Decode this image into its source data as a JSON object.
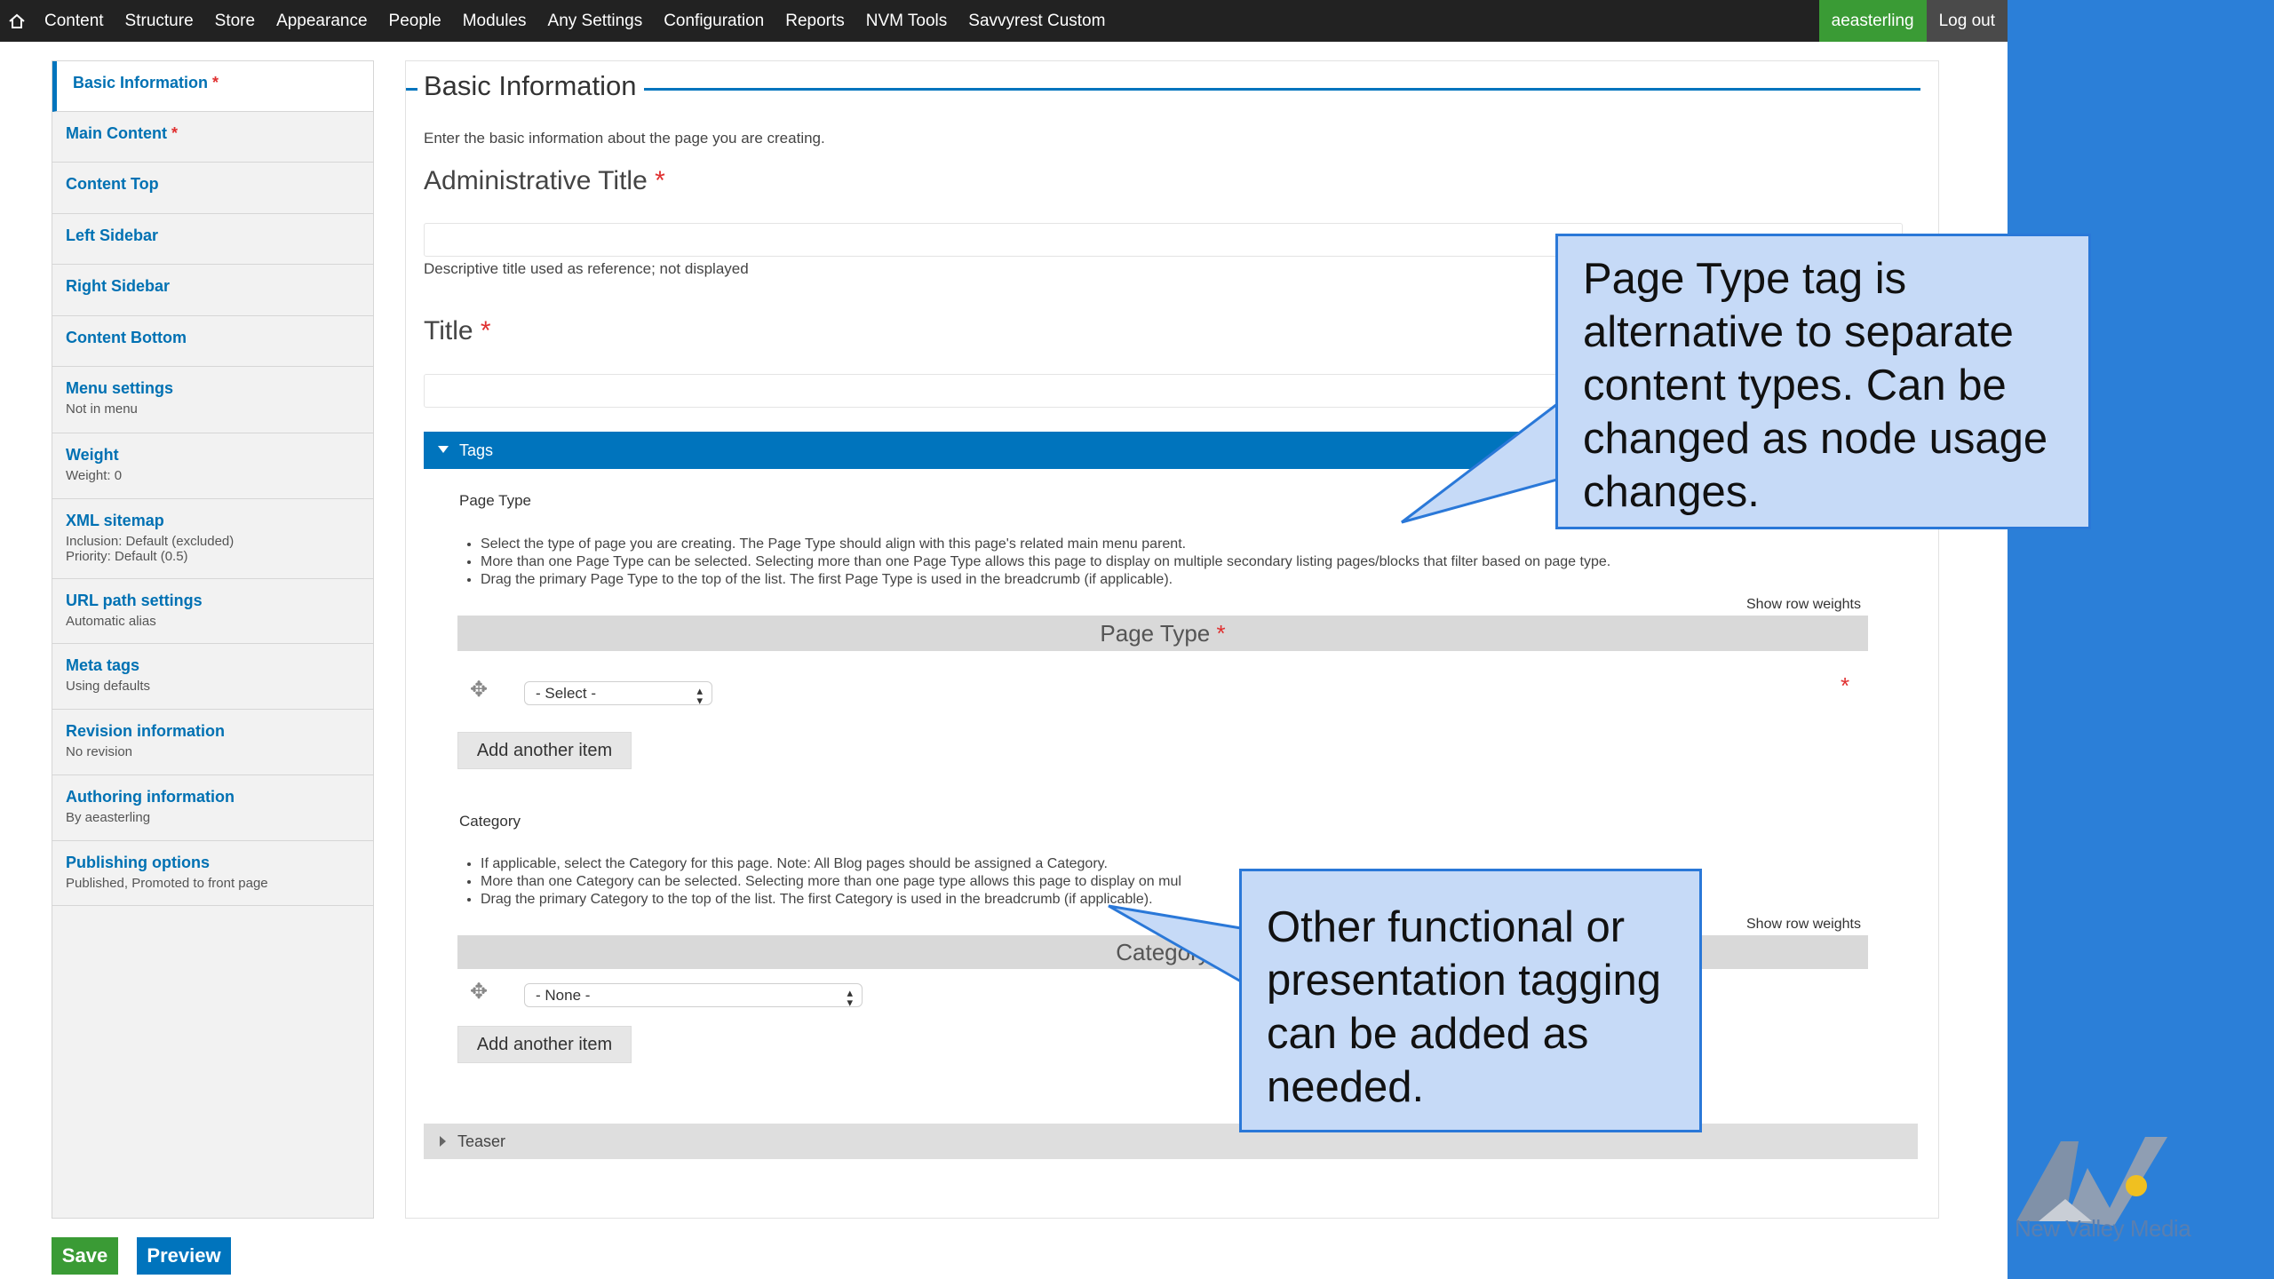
{
  "toolbar": {
    "menu": [
      "Content",
      "Structure",
      "Store",
      "Appearance",
      "People",
      "Modules",
      "Any Settings",
      "Configuration",
      "Reports",
      "NVM Tools",
      "Savvyrest Custom"
    ],
    "user": "aeasterling",
    "logout": "Log out"
  },
  "sidebar": {
    "items": [
      {
        "title": "Basic Information",
        "required": "*",
        "summary": ""
      },
      {
        "title": "Main Content",
        "required": "*",
        "summary": ""
      },
      {
        "title": "Content Top",
        "required": "",
        "summary": ""
      },
      {
        "title": "Left Sidebar",
        "required": "",
        "summary": ""
      },
      {
        "title": "Right Sidebar",
        "required": "",
        "summary": ""
      },
      {
        "title": "Content Bottom",
        "required": "",
        "summary": ""
      },
      {
        "title": "Menu settings",
        "required": "",
        "summary": "Not in menu"
      },
      {
        "title": "Weight",
        "required": "",
        "summary": "Weight: 0"
      },
      {
        "title": "XML sitemap",
        "required": "",
        "summary": "Inclusion: Default (excluded)",
        "summary2": "Priority: Default (0.5)"
      },
      {
        "title": "URL path settings",
        "required": "",
        "summary": "Automatic alias"
      },
      {
        "title": "Meta tags",
        "required": "",
        "summary": "Using defaults"
      },
      {
        "title": "Revision information",
        "required": "",
        "summary": "No revision"
      },
      {
        "title": "Authoring information",
        "required": "",
        "summary": "By aeasterling"
      },
      {
        "title": "Publishing options",
        "required": "",
        "summary": "Published, Promoted to front page"
      }
    ]
  },
  "main": {
    "legend": "Basic Information",
    "intro": "Enter the basic information about the page you are creating.",
    "admin_title_label": "Administrative Title",
    "admin_title_desc": "Descriptive title used as reference; not displayed",
    "title_label": "Title",
    "required_mark": "*",
    "tags_label": "Tags",
    "page_type": {
      "label": "Page Type",
      "help": [
        "Select the type of page you are creating. The Page Type should align with this page's related main menu parent.",
        "More than one Page Type can be selected. Selecting more than one Page Type allows this page to display on multiple secondary listing pages/blocks that filter based on page type.",
        "Drag the primary Page Type to the top of the list. The first Page Type is used in the breadcrumb (if applicable)."
      ],
      "show_row_weights": "Show row weights",
      "table_header": "Page Type",
      "select_value": "- Select -",
      "add_button": "Add another item"
    },
    "category": {
      "label": "Category",
      "help": [
        "If applicable, select the Category for this page. Note: All Blog pages should be assigned a Category.",
        "More than one Category can be selected. Selecting more than one page type allows this page to display on mul",
        "Drag the primary Category to the top of the list. The first Category is used in the breadcrumb (if applicable)."
      ],
      "show_row_weights": "Show row weights",
      "table_header": "Category",
      "select_value": "- None -",
      "add_button": "Add another item"
    },
    "teaser_label": "Teaser"
  },
  "actions": {
    "save": "Save",
    "preview": "Preview"
  },
  "callouts": {
    "page_type": [
      "Page Type tag is",
      "alternative to separate",
      "content types. Can be",
      "changed as node usage",
      "changes."
    ],
    "other": [
      "Other functional or",
      "presentation tagging",
      "can be added as",
      "needed."
    ]
  },
  "logo": {
    "text": "New Valley Media"
  },
  "colors": {
    "toolbar": "#222222",
    "accent": "#0074bd",
    "green": "#3a9b35",
    "callout_fill": "#c6daf7",
    "callout_border": "#2a78d8",
    "side_panel": "#2b7fd8"
  }
}
